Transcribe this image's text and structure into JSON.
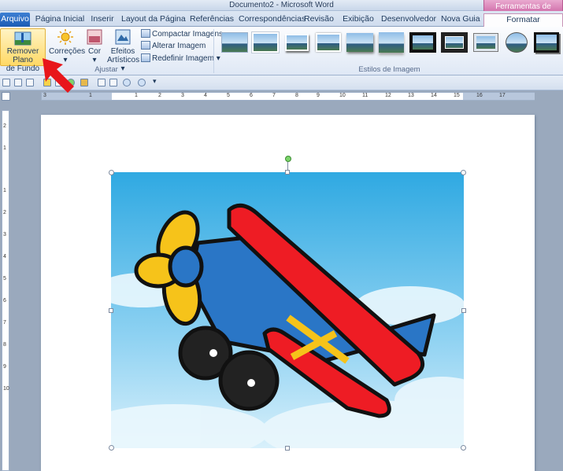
{
  "window": {
    "title": "Documento2 - Microsoft Word",
    "contextual_tab_group": "Ferramentas de Imagem"
  },
  "tabs": [
    {
      "id": "arquivo",
      "label": "Arquivo"
    },
    {
      "id": "pagina-inicial",
      "label": "Página Inicial"
    },
    {
      "id": "inserir",
      "label": "Inserir"
    },
    {
      "id": "layout",
      "label": "Layout da Página"
    },
    {
      "id": "referencias",
      "label": "Referências"
    },
    {
      "id": "correspondencias",
      "label": "Correspondências"
    },
    {
      "id": "revisao",
      "label": "Revisão"
    },
    {
      "id": "exibicao",
      "label": "Exibição"
    },
    {
      "id": "desenvolvedor",
      "label": "Desenvolvedor"
    },
    {
      "id": "nova-guia",
      "label": "Nova Guia"
    },
    {
      "id": "formatar",
      "label": "Formatar",
      "active": true
    }
  ],
  "ribbon": {
    "adjust": {
      "remove_background_line1": "Remover Plano",
      "remove_background_line2": "de Fundo",
      "corrections": "Correções",
      "color": "Cor",
      "effects_line1": "Efeitos",
      "effects_line2": "Artísticos",
      "compress": "Compactar Imagens",
      "change": "Alterar Imagem",
      "reset": "Redefinir Imagem",
      "group_label": "Ajustar"
    },
    "styles": {
      "group_label": "Estilos de Imagem",
      "count": 11
    }
  },
  "ruler": {
    "marks": [
      "3",
      "1",
      "1",
      "2",
      "3",
      "4",
      "5",
      "6",
      "7",
      "8",
      "9",
      "10",
      "11",
      "12",
      "13",
      "14",
      "15",
      "16",
      "17"
    ],
    "vertical_marks": [
      "2",
      "1",
      "1",
      "2",
      "3",
      "4",
      "5",
      "6",
      "7",
      "8",
      "9",
      "10"
    ]
  },
  "colors": {
    "accent_tab": "#cf6aa7",
    "file_tab": "#1c5bb4",
    "sky": "#3fb4e6",
    "plane_red": "#ee1c24",
    "plane_blue": "#2a76c6",
    "propeller_yellow": "#f6c31a",
    "callout_arrow": "#e8161b"
  }
}
